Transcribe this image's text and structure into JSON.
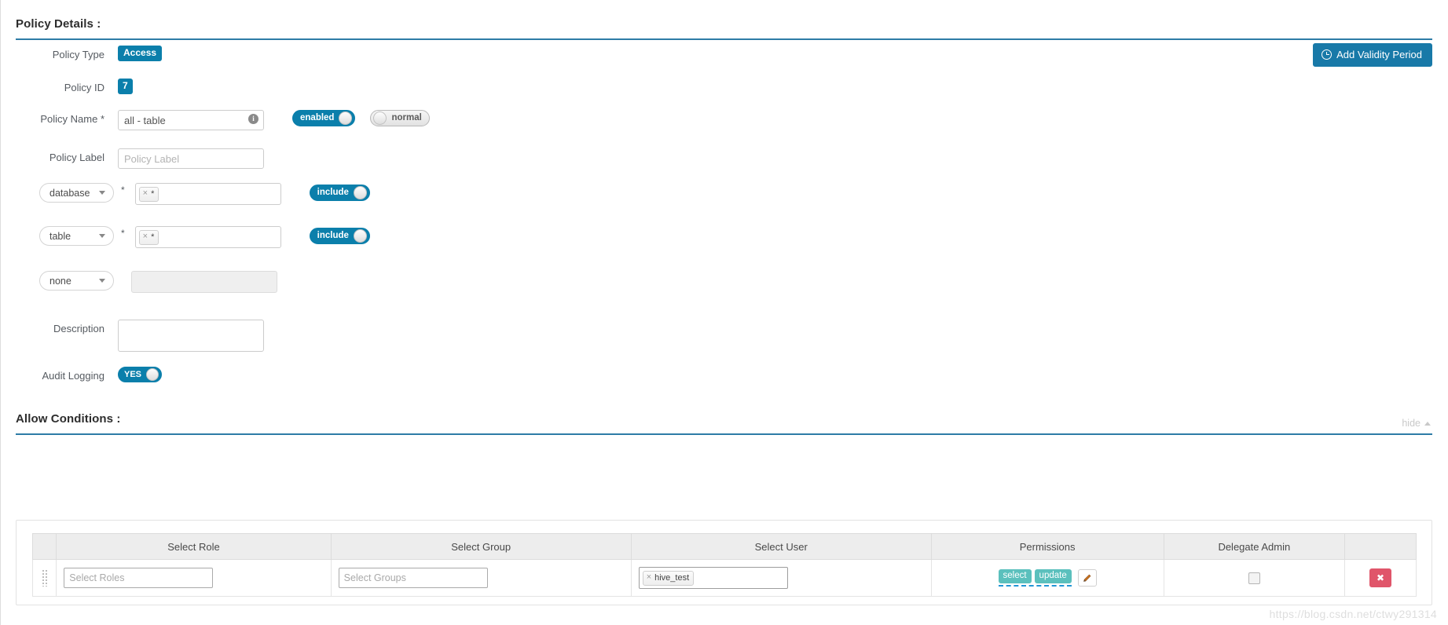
{
  "policy_details": {
    "section_title": "Policy Details :",
    "add_validity_button": "Add Validity Period",
    "fields": {
      "policy_type_label": "Policy Type",
      "policy_type_value": "Access",
      "policy_id_label": "Policy ID",
      "policy_id_value": "7",
      "policy_name_label": "Policy Name *",
      "policy_name_value": "all - table",
      "policy_name_info": "i",
      "status_toggle": "enabled",
      "priority_toggle": "normal",
      "policy_label_label": "Policy Label",
      "policy_label_placeholder": "Policy Label",
      "policy_label_value": "",
      "description_label": "Description",
      "description_value": "",
      "audit_logging_label": "Audit Logging",
      "audit_logging_toggle": "YES"
    },
    "resources": [
      {
        "type": "database",
        "required": "*",
        "token_value": "*",
        "token_remove": "×",
        "include_toggle": "include",
        "disabled": false
      },
      {
        "type": "table",
        "required": "*",
        "token_value": "*",
        "token_remove": "×",
        "include_toggle": "include",
        "disabled": false
      },
      {
        "type": "none",
        "required": "",
        "token_value": "",
        "token_remove": "",
        "include_toggle": "",
        "disabled": true
      }
    ]
  },
  "allow_conditions": {
    "section_title": "Allow Conditions :",
    "hide_label": "hide",
    "columns": [
      "Select Role",
      "Select Group",
      "Select User",
      "Permissions",
      "Delegate Admin"
    ],
    "rows": [
      {
        "role_placeholder": "Select Roles",
        "role_value": "",
        "group_placeholder": "Select Groups",
        "group_value": "",
        "user_token": "hive_test",
        "user_token_remove": "×",
        "permissions": [
          "select",
          "update"
        ],
        "edit_icon": "pencil-icon",
        "delegate_admin_checked": false,
        "delete_label": "✖"
      }
    ]
  },
  "watermark": "https://blog.csdn.net/ctwy291314",
  "colors": {
    "accent": "#0b7fab",
    "rule": "#2e7ca6",
    "permission_badge": "#5bc0bd",
    "delete": "#e0556a"
  }
}
